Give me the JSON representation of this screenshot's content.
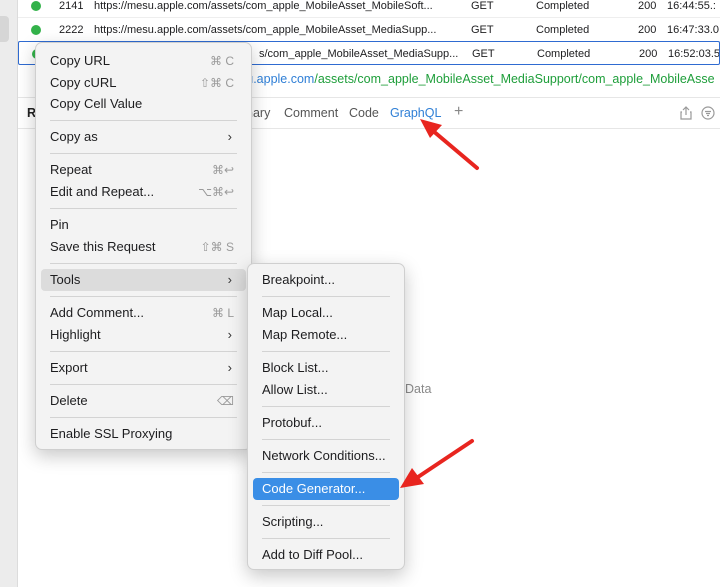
{
  "requests": [
    {
      "id": "2141",
      "url": "https://mesu.apple.com/assets/com_apple_MobileAsset_MobileSoft...",
      "method": "GET",
      "status": "Completed",
      "code": "200",
      "time": "16:44:55.:"
    },
    {
      "id": "2222",
      "url": "https://mesu.apple.com/assets/com_apple_MobileAsset_MediaSupp...",
      "method": "GET",
      "status": "Completed",
      "code": "200",
      "time": "16:47:33.0"
    },
    {
      "id": "",
      "url": "s/com_apple_MobileAsset_MediaSupp...",
      "method": "GET",
      "status": "Completed",
      "code": "200",
      "time": "16:52:03.5"
    }
  ],
  "detail": {
    "url_host": "su.apple.com",
    "url_path": "/assets/com_apple_MobileAsset_MediaSupport/com_apple_MobileAsse",
    "r_letter": "R",
    "tabs": [
      "nary",
      "Comment",
      "Code",
      "GraphQL"
    ],
    "add_tab": "+",
    "empty_text": "Data"
  },
  "context_menu": {
    "items": [
      {
        "label": "Copy URL",
        "shortcut": "⌘ C"
      },
      {
        "label": "Copy cURL",
        "shortcut": "⇧⌘ C"
      },
      {
        "label": "Copy Cell Value",
        "shortcut": ""
      },
      {
        "label": "Copy as",
        "submenu_glyph": "›"
      },
      {
        "label": "Repeat",
        "shortcut": "⌘↩"
      },
      {
        "label": "Edit and Repeat...",
        "shortcut": "⌥⌘↩"
      },
      {
        "label": "Pin",
        "shortcut": ""
      },
      {
        "label": "Save this Request",
        "shortcut": "⇧⌘ S"
      },
      {
        "label": "Tools",
        "submenu_glyph": "›"
      },
      {
        "label": "Add Comment...",
        "shortcut": "⌘ L"
      },
      {
        "label": "Highlight",
        "submenu_glyph": "›"
      },
      {
        "label": "Export",
        "submenu_glyph": "›"
      },
      {
        "label": "Delete",
        "shortcut": "⌫"
      },
      {
        "label": "Enable SSL Proxying",
        "shortcut": ""
      }
    ]
  },
  "tools_submenu": {
    "items": [
      {
        "label": "Breakpoint..."
      },
      {
        "label": "Map Local..."
      },
      {
        "label": "Map Remote..."
      },
      {
        "label": "Block List..."
      },
      {
        "label": "Allow List..."
      },
      {
        "label": "Protobuf..."
      },
      {
        "label": "Network Conditions..."
      },
      {
        "label": "Code Generator..."
      },
      {
        "label": "Scripting..."
      },
      {
        "label": "Add to Diff Pool..."
      }
    ]
  },
  "colors": {
    "accent": "#3a8ee6",
    "annotation_arrow": "#e8251f",
    "status_dot": "#33b24a"
  }
}
